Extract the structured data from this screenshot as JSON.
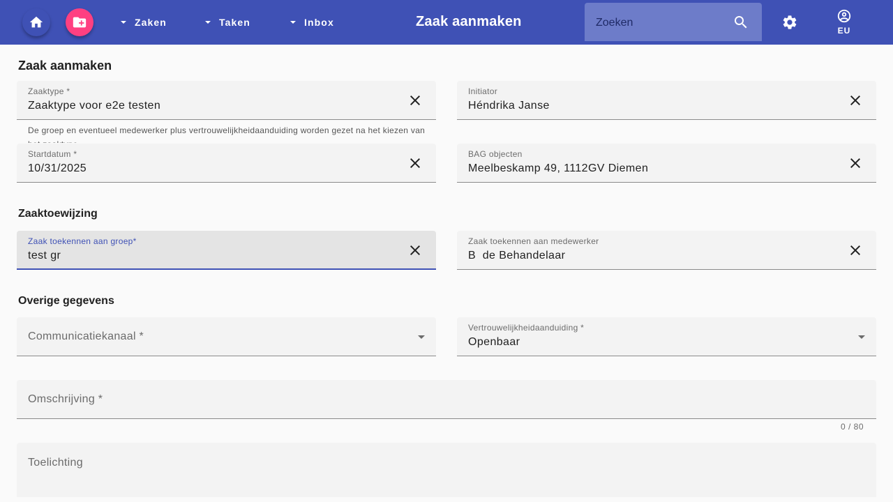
{
  "topbar": {
    "nav": [
      {
        "label": "Zaken"
      },
      {
        "label": "Taken"
      },
      {
        "label": "Inbox"
      }
    ],
    "title": "Zaak aanmaken",
    "search_placeholder": "Zoeken",
    "user_initials": "EU",
    "colors": {
      "bar": "#3f51b5",
      "new_button": "#ff4081"
    }
  },
  "form": {
    "title": "Zaak aanmaken",
    "zaaktype": {
      "label": "Zaaktype *",
      "value": "Zaaktype voor e2e testen",
      "hint": "De groep en eventueel medewerker plus vertrouwelijkheidaanduiding worden gezet na het kiezen van het zaaktype"
    },
    "initiator": {
      "label": "Initiator",
      "value": "Héndrika Janse"
    },
    "startdatum": {
      "label": "Startdatum *",
      "value": "10/31/2025"
    },
    "bag_objecten": {
      "label": "BAG objecten",
      "value": "Meelbeskamp 49, 1112GV Diemen"
    },
    "section_toewijzing": "Zaaktoewijzing",
    "groep": {
      "label": "Zaak toekennen aan groep*",
      "value": "test gr"
    },
    "medewerker": {
      "label": "Zaak toekennen aan medewerker",
      "value": "B  de Behandelaar"
    },
    "section_overige": "Overige gegevens",
    "communicatiekanaal": {
      "placeholder": "Communicatiekanaal *"
    },
    "vertrouwelijkheid": {
      "label": "Vertrouwelijkheidaanduiding *",
      "value": "Openbaar"
    },
    "omschrijving": {
      "placeholder": "Omschrijving *",
      "counter": "0 / 80"
    },
    "toelichting": {
      "placeholder": "Toelichting"
    }
  }
}
